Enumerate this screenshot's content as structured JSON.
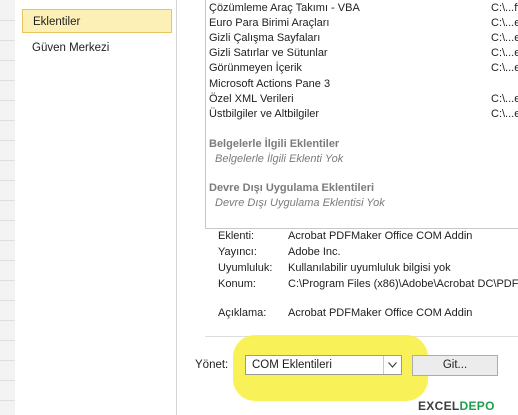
{
  "sidebar": {
    "items": [
      {
        "label": "Eklentiler",
        "active": true
      },
      {
        "label": "Güven Merkezi",
        "active": false
      }
    ]
  },
  "addins": {
    "active_rows": [
      {
        "name": "Çözümleme Araç Takımı - VBA",
        "location": "C:\\...ff"
      },
      {
        "name": "Euro Para Birimi Araçları",
        "location": "C:\\...e"
      },
      {
        "name": "Gizli Çalışma Sayfaları",
        "location": "C:\\...e"
      },
      {
        "name": "Gizli Satırlar ve Sütunlar",
        "location": "C:\\...e"
      },
      {
        "name": "Görünmeyen İçerik",
        "location": "C:\\...e"
      },
      {
        "name": "Microsoft Actions Pane 3",
        "location": ""
      },
      {
        "name": "Özel XML Verileri",
        "location": "C:\\...e"
      },
      {
        "name": "Üstbilgiler ve Altbilgiler",
        "location": "C:\\...e"
      }
    ],
    "document_section": {
      "heading": "Belgelerle İlgili Eklentiler",
      "empty": "Belgelerle İlgili Eklenti Yok"
    },
    "disabled_section": {
      "heading": "Devre Dışı Uygulama Eklentileri",
      "empty": "Devre Dışı Uygulama Eklentisi Yok"
    }
  },
  "details": {
    "addin": {
      "label": "Eklenti:",
      "value": "Acrobat PDFMaker Office COM Addin"
    },
    "publisher": {
      "label": "Yayıncı:",
      "value": "Adobe Inc."
    },
    "compat": {
      "label": "Uyumluluk:",
      "value": "Kullanılabilir uyumluluk bilgisi yok"
    },
    "location": {
      "label": "Konum:",
      "value": "C:\\Program Files (x86)\\Adobe\\Acrobat DC\\PDF"
    },
    "description": {
      "label": "Açıklama:",
      "value": "Acrobat PDFMaker Office COM Addin"
    }
  },
  "manage": {
    "label": "Yönet:",
    "selected": "COM Eklentileri",
    "go_label": "Git..."
  },
  "logo": {
    "part1": "EXCEL",
    "part2": "DEPO"
  },
  "colors": {
    "highlight": "#f7f04a",
    "active_nav": "#fdf0b6",
    "logo_green": "#1f9f4b"
  }
}
